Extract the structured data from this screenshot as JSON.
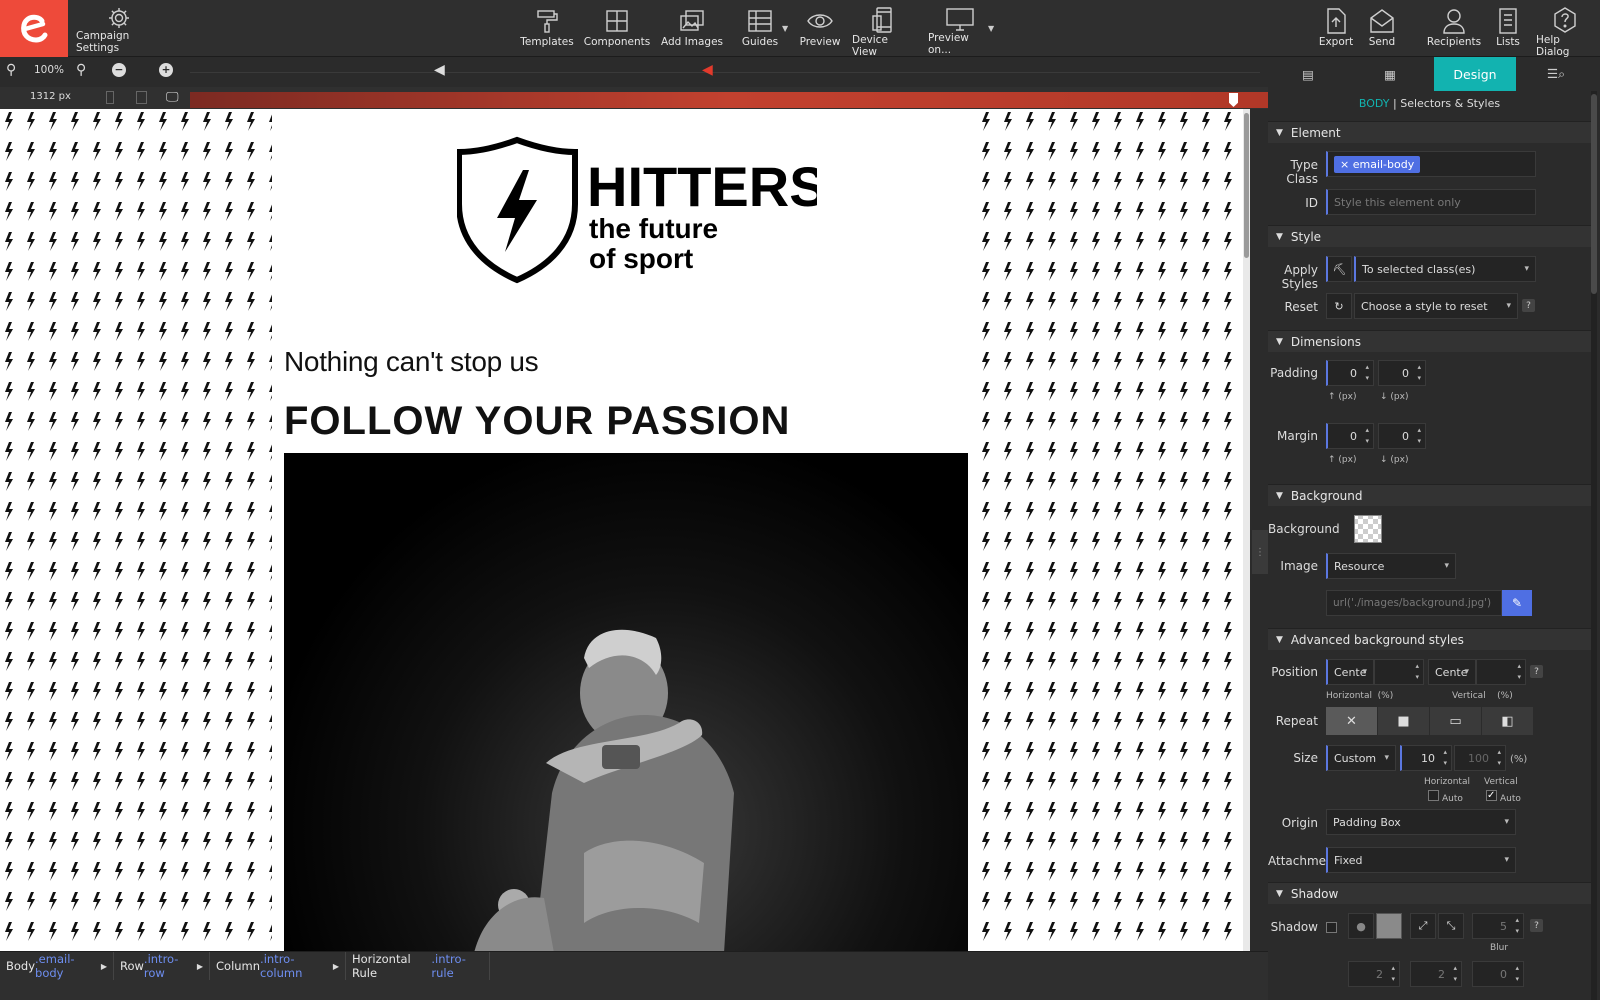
{
  "toolbar": {
    "campaign_settings": "Campaign Settings",
    "templates": "Templates",
    "components": "Components",
    "add_images": "Add Images",
    "guides": "Guides",
    "preview": "Preview",
    "device_view": "Device View",
    "preview_on": "Preview on...",
    "export": "Export",
    "send": "Send",
    "recipients": "Recipients",
    "lists": "Lists",
    "help_dialog": "Help Dialog"
  },
  "zoom": {
    "level": "100%",
    "width": "1312 px"
  },
  "email": {
    "brand_name": "HITTERS",
    "brand_line1": "the future",
    "brand_line2": "of sport",
    "tagline": "Nothing can't stop us",
    "headline": "FOLLOW YOUR PASSION"
  },
  "breadcrumbs": [
    {
      "tag": "Body",
      "cls": ".email-body"
    },
    {
      "tag": "Row",
      "cls": ".intro-row"
    },
    {
      "tag": "Column",
      "cls": ".intro-column"
    },
    {
      "tag": "Horizontal Rule",
      "cls": ".intro-rule"
    }
  ],
  "panel": {
    "tab_design": "Design",
    "selector_body": "BODY",
    "selector_rest": " | Selectors & Styles",
    "element": {
      "title": "Element",
      "type_class_label": "Type Class",
      "type_class_chip": "email-body",
      "id_label": "ID",
      "id_placeholder": "Style this element only"
    },
    "style": {
      "title": "Style",
      "apply_label": "Apply Styles",
      "apply_value": "To selected class(es)",
      "reset_label": "Reset",
      "reset_value": "Choose a style to reset"
    },
    "dimensions": {
      "title": "Dimensions",
      "padding_label": "Padding",
      "padding_top": "0",
      "padding_bottom": "0",
      "margin_label": "Margin",
      "margin_top": "0",
      "margin_bottom": "0",
      "unit_up": "↑ (px)",
      "unit_down": "↓ (px)"
    },
    "background": {
      "title": "Background",
      "bg_label": "Background",
      "image_label": "Image",
      "image_value": "Resource",
      "url_value": "url('./images/background.jpg')"
    },
    "advanced": {
      "title": "Advanced background styles",
      "position_label": "Position",
      "pos_h": "Cente",
      "pos_v": "Cente",
      "horizontal_pct": "Horizontal  (%)",
      "vertical_pct": "Vertical    (%)",
      "repeat_label": "Repeat",
      "size_label": "Size",
      "size_value": "Custom",
      "size_h": "10",
      "size_v": "100",
      "size_unit": "(%)",
      "horizontal": "Horizontal",
      "vertical": "Vertical",
      "auto1": "Auto",
      "auto2": "Auto",
      "origin_label": "Origin",
      "origin_value": "Padding Box",
      "attachment_label": "Attachment",
      "attachment_value": "Fixed"
    },
    "shadow": {
      "title": "Shadow",
      "shadow_label": "Shadow",
      "blur_value": "5",
      "blur_label": "Blur",
      "v1": "2",
      "v2": "2",
      "v3": "0"
    }
  }
}
